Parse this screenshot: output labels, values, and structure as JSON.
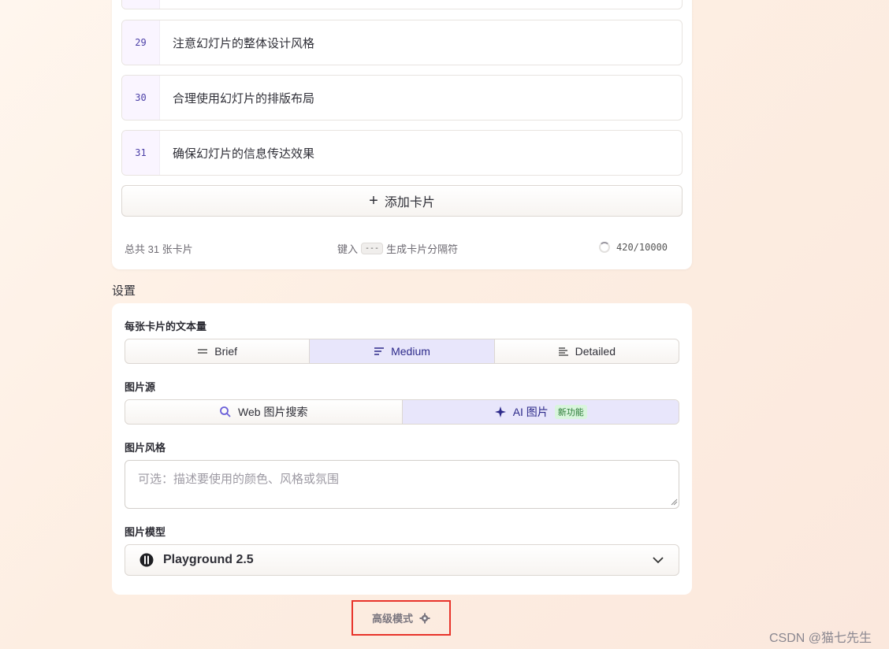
{
  "cards": [
    {
      "num": "29",
      "text": "注意幻灯片的整体设计风格"
    },
    {
      "num": "30",
      "text": "合理使用幻灯片的排版布局"
    },
    {
      "num": "31",
      "text": "确保幻灯片的信息传达效果"
    }
  ],
  "add_card_label": "添加卡片",
  "footer": {
    "total": "总共 31 张卡片",
    "hint_prefix": "键入",
    "hint_kbd": "---",
    "hint_suffix": "生成卡片分隔符",
    "counter": "420/10000"
  },
  "settings": {
    "title": "设置",
    "text_amount": {
      "label": "每张卡片的文本量",
      "options": [
        "Brief",
        "Medium",
        "Detailed"
      ],
      "selected": "Medium"
    },
    "image_source": {
      "label": "图片源",
      "options": [
        "Web 图片搜索",
        "AI 图片"
      ],
      "badge": "新功能",
      "selected": "AI 图片"
    },
    "image_style": {
      "label": "图片风格",
      "placeholder": "可选：描述要使用的颜色、风格或氛围"
    },
    "image_model": {
      "label": "图片模型",
      "value": "Playground 2.5"
    }
  },
  "advanced_mode": "高级模式",
  "watermark": "CSDN @猫七先生",
  "colors": {
    "accent": "#2d2a8a",
    "active_bg": "#e8e6fb",
    "highlight_border": "#e8332a",
    "badge_bg": "#d9f5dd"
  }
}
